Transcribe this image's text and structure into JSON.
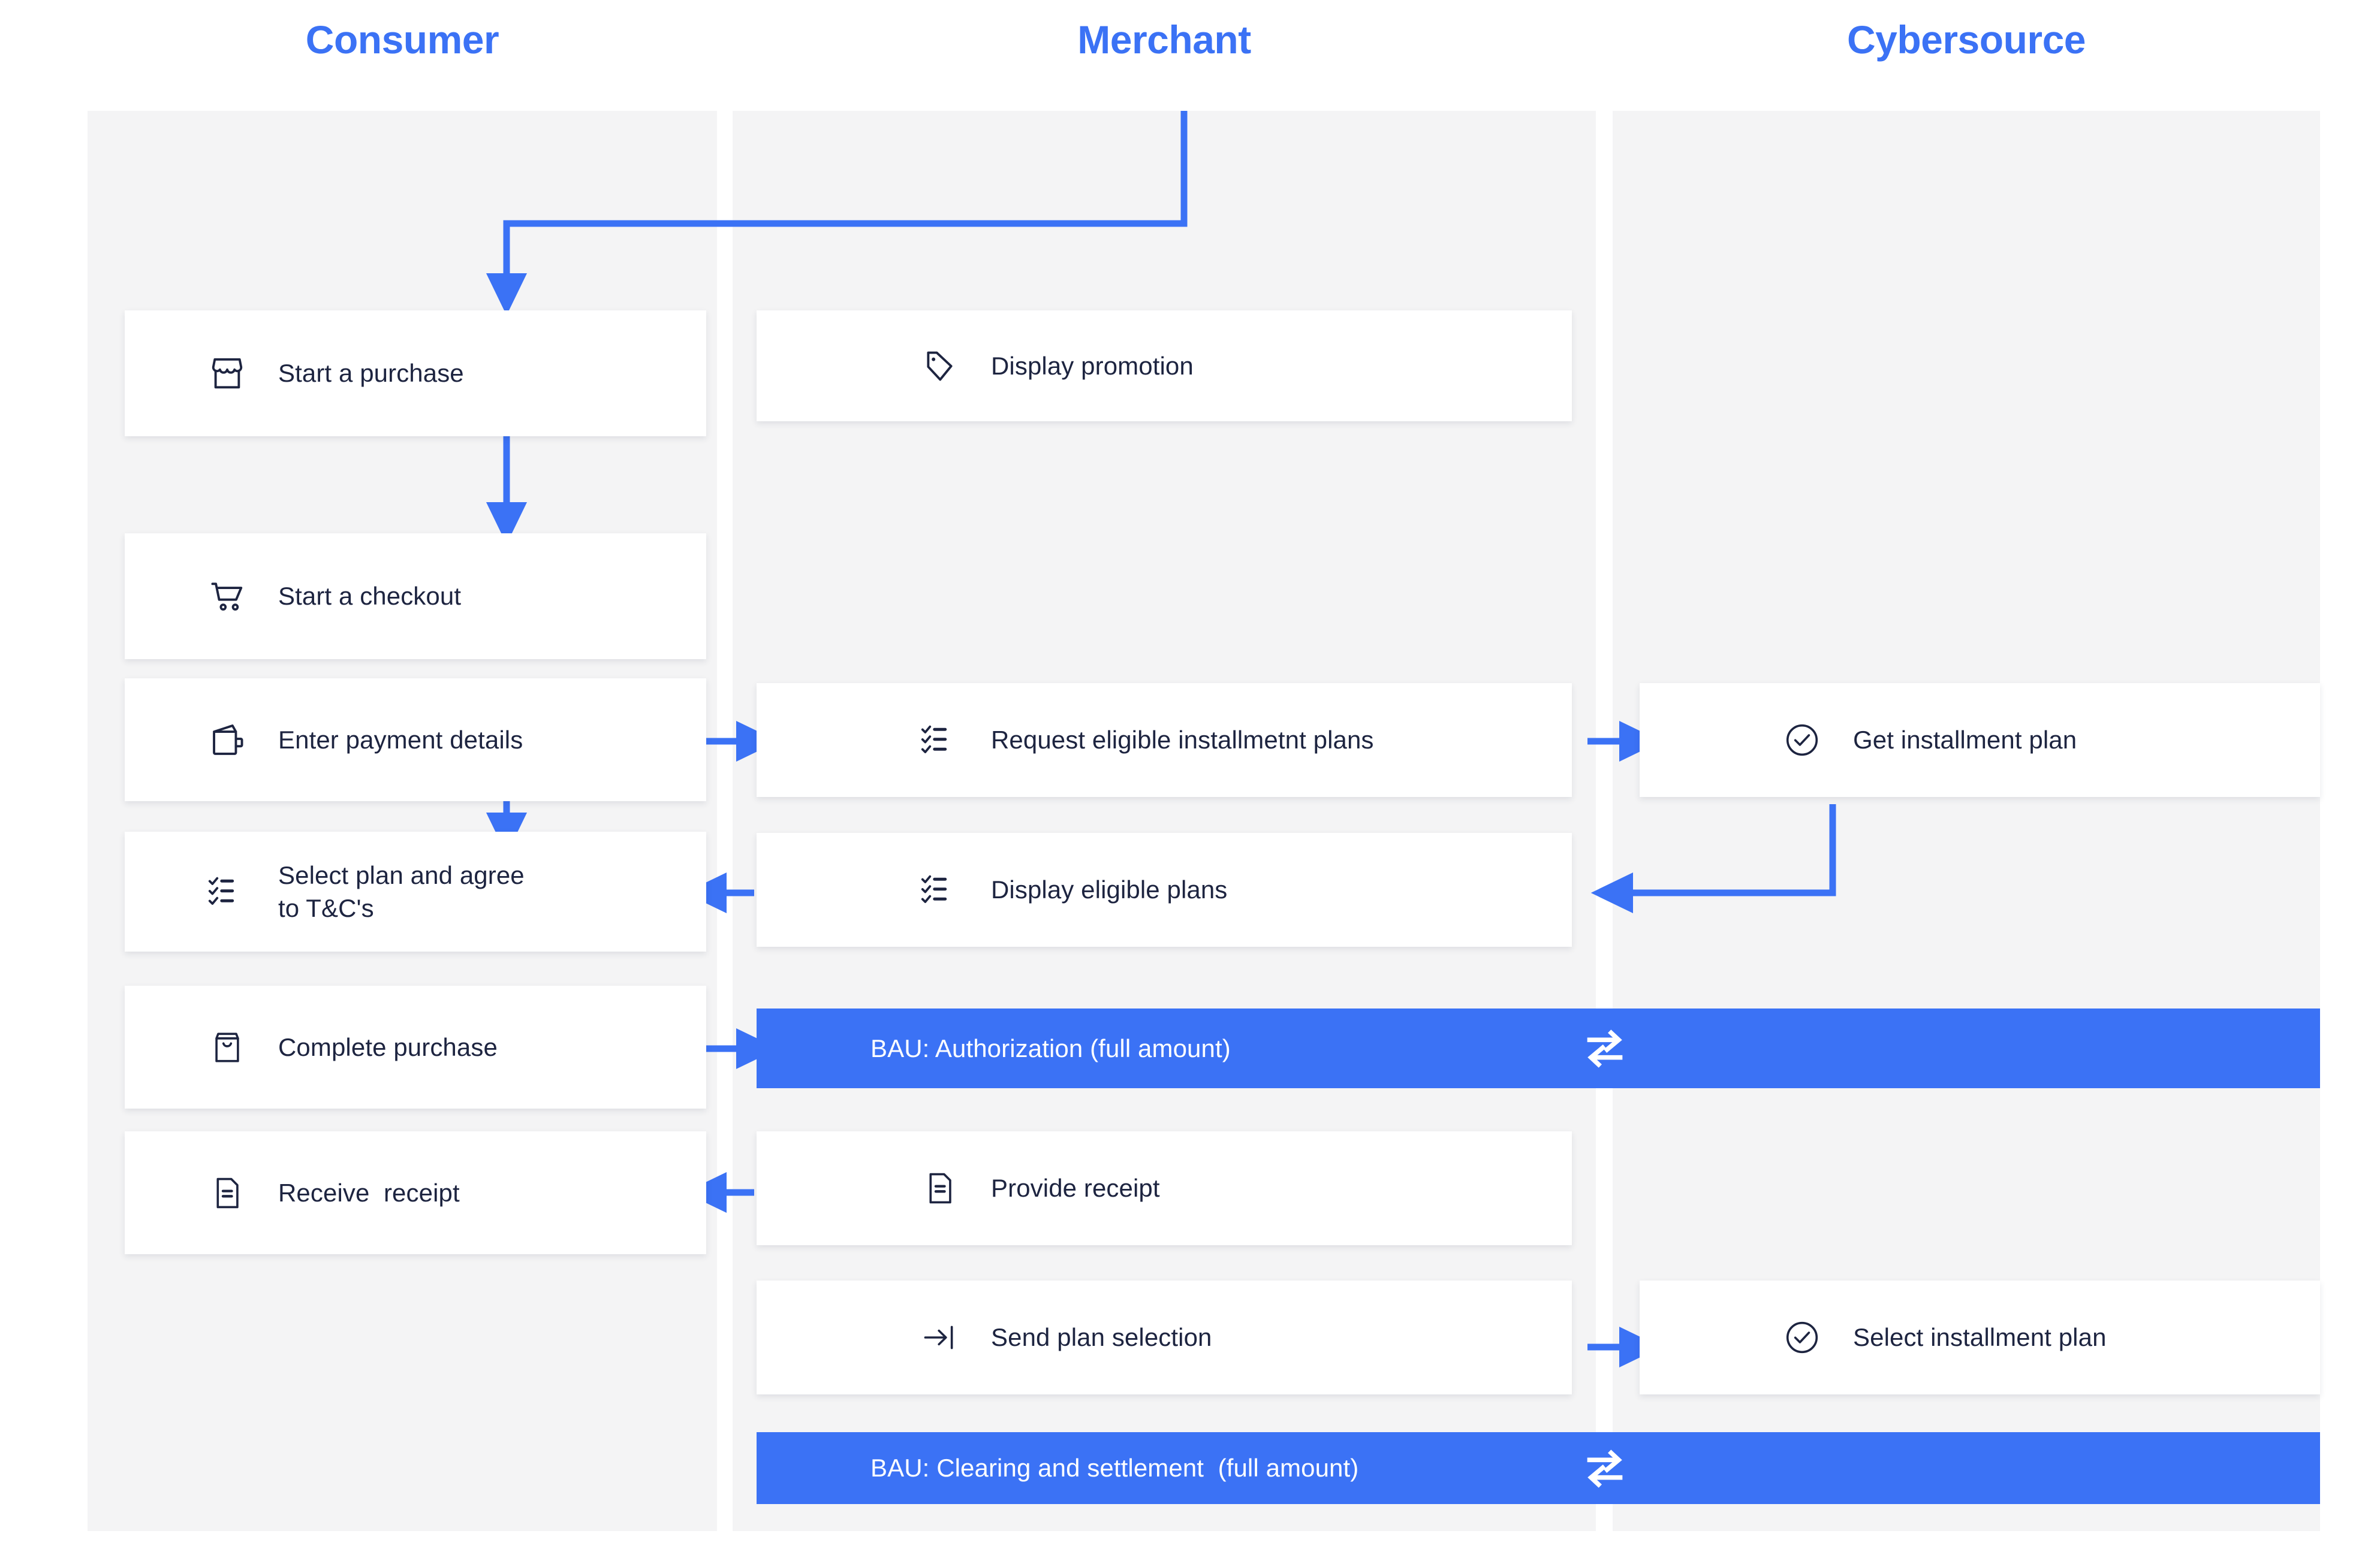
{
  "theme": {
    "accent": "#3b72f5",
    "ink": "#1d2440",
    "lane_bg": "#f4f4f5",
    "card_bg": "#ffffff",
    "page_bg": "#ffffff"
  },
  "lanes": [
    {
      "id": "consumer",
      "title": "Consumer"
    },
    {
      "id": "merchant",
      "title": "Merchant"
    },
    {
      "id": "cybersource",
      "title": "Cybersource"
    }
  ],
  "consumer_steps": [
    {
      "icon": "storefront-icon",
      "label": "Start a purchase"
    },
    {
      "icon": "shopping-cart-icon",
      "label": "Start a checkout"
    },
    {
      "icon": "wallet-icon",
      "label": "Enter payment details"
    },
    {
      "icon": "checklist-icon",
      "label": "Select plan and agree\nto T&C's"
    },
    {
      "icon": "shopping-bag-icon",
      "label": "Complete purchase"
    },
    {
      "icon": "document-icon",
      "label": "Receive  receipt"
    }
  ],
  "merchant_steps": [
    {
      "icon": "price-tag-icon",
      "label": "Display promotion"
    },
    {
      "icon": "checklist-icon",
      "label": "Request eligible installmetnt plans"
    },
    {
      "icon": "checklist-icon",
      "label": "Display eligible plans"
    },
    {
      "icon": "document-icon",
      "label": "Provide receipt"
    },
    {
      "icon": "arrow-to-bar-icon",
      "label": "Send plan selection"
    }
  ],
  "cybersource_steps": [
    {
      "icon": "check-circle-icon",
      "label": "Get installment plan"
    },
    {
      "icon": "check-circle-icon",
      "label": "Select installment plan"
    }
  ],
  "bau_banners": [
    {
      "id": "authorization",
      "label": "BAU: Authorization (full amount)",
      "icon": "exchange-arrows-icon"
    },
    {
      "id": "clearing",
      "label": "BAU: Clearing and settlement  (full amount)",
      "icon": "exchange-arrows-icon"
    }
  ]
}
